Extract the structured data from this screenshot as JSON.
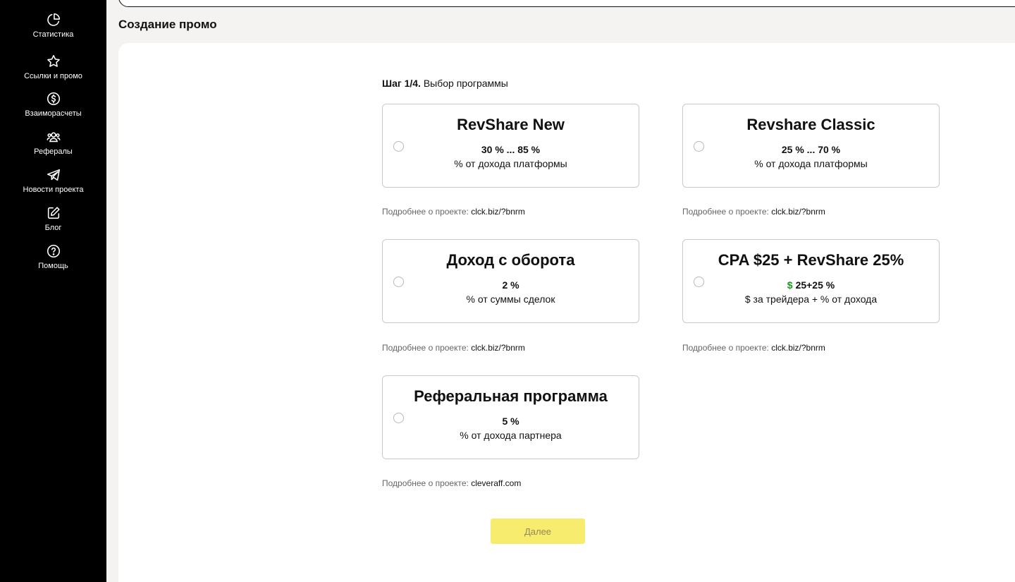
{
  "sidebar": {
    "items": [
      {
        "label": "Статистика",
        "icon": "pie-chart-icon"
      },
      {
        "label": "Ссылки и промо",
        "icon": "star-icon"
      },
      {
        "label": "Взаиморасчеты",
        "icon": "dollar-circle-icon"
      },
      {
        "label": "Рефералы",
        "icon": "users-icon"
      },
      {
        "label": "Новости проекта",
        "icon": "telegram-icon"
      },
      {
        "label": "Блог",
        "icon": "edit-icon"
      },
      {
        "label": "Помощь",
        "icon": "help-icon"
      }
    ]
  },
  "page": {
    "title": "Создание промо",
    "step_number": "Шаг 1/4.",
    "step_text": " Выбор программы"
  },
  "programs": [
    {
      "title": "RevShare New",
      "rate": "30 % ... 85 %",
      "rate_prefix": "",
      "desc": "% от дохода платформы",
      "more_label": "Подробнее о проекте:",
      "link": "clck.biz/?bnrm"
    },
    {
      "title": "Revshare Classic",
      "rate": "25 % ... 70 %",
      "rate_prefix": "",
      "desc": "% от дохода платформы",
      "more_label": "Подробнее о проекте:",
      "link": "clck.biz/?bnrm"
    },
    {
      "title": "Доход с оборота",
      "rate": "2 %",
      "rate_prefix": "",
      "desc": "% от суммы сделок",
      "more_label": "Подробнее о проекте:",
      "link": "clck.biz/?bnrm"
    },
    {
      "title": "CPA $25 + RevShare 25%",
      "rate": "25+25 %",
      "rate_prefix": "$",
      "desc": "$ за трейдера + % от дохода",
      "more_label": "Подробнее о проекте:",
      "link": "clck.biz/?bnrm"
    },
    {
      "title": "Реферальная программа",
      "rate": "5 %",
      "rate_prefix": "",
      "desc": "% от дохода партнера",
      "more_label": "Подробнее о проекте:",
      "link": "cleveraff.com"
    }
  ],
  "actions": {
    "next_label": "Далее"
  },
  "colors": {
    "sidebar_bg": "#000000",
    "accent_yellow": "#f7ec6e",
    "dollar_green": "#1a9a1a"
  }
}
